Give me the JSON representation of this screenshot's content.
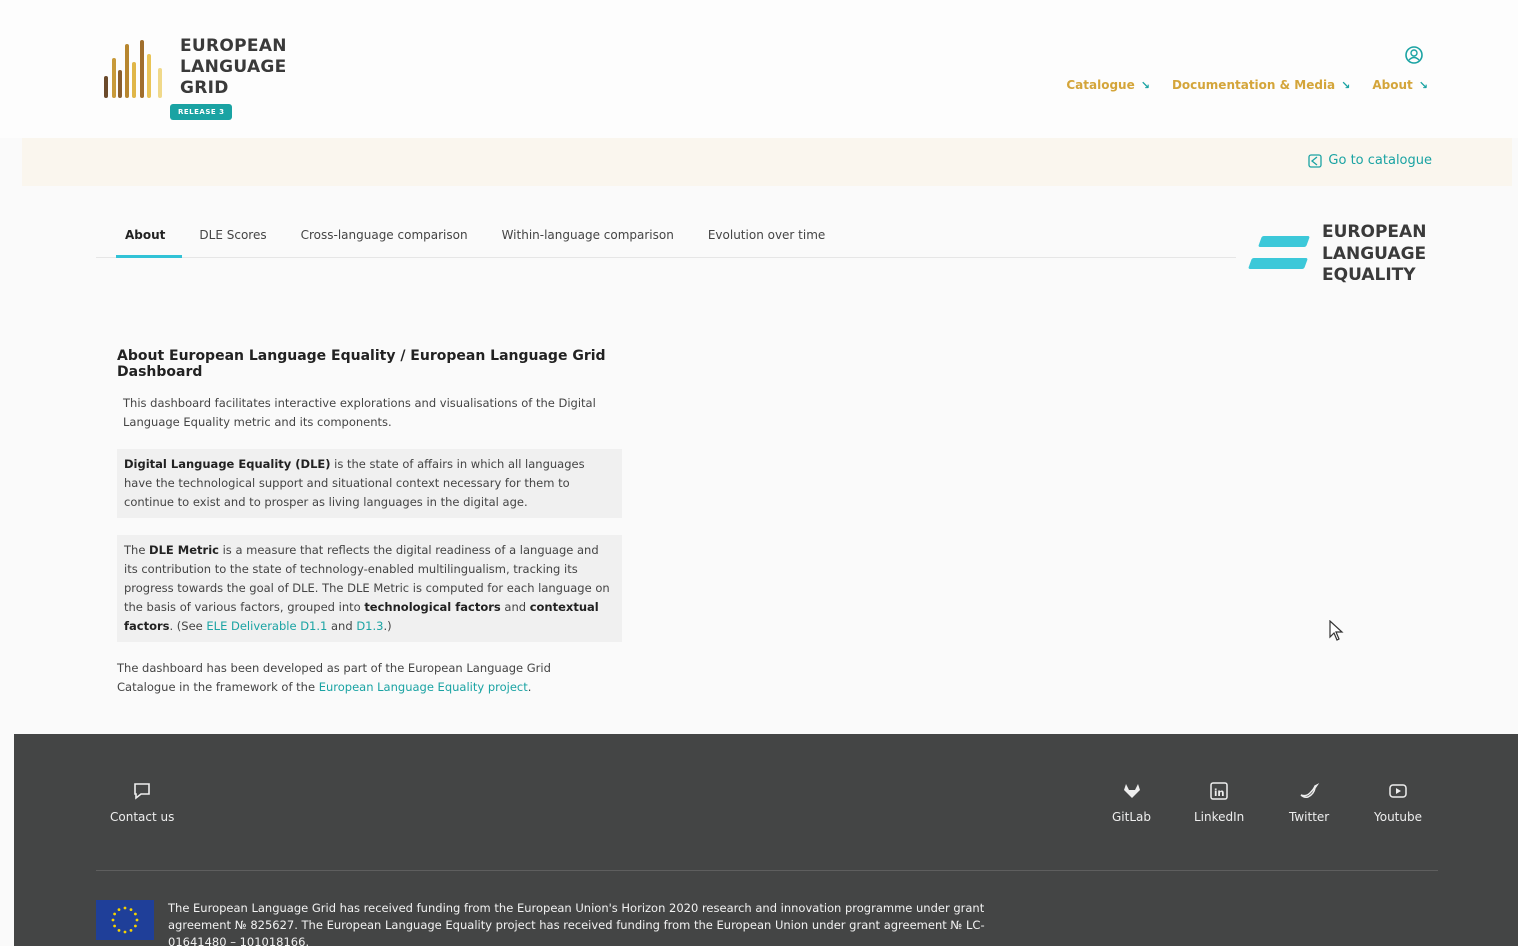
{
  "header": {
    "logo_lines": [
      "EUROPEAN",
      "LANGUAGE",
      "GRID"
    ],
    "release_badge": "RELEASE 3",
    "nav": [
      {
        "label": "Catalogue"
      },
      {
        "label": "Documentation & Media"
      },
      {
        "label": "About"
      }
    ],
    "go_to_catalogue": "Go to catalogue"
  },
  "tabs": [
    {
      "label": "About",
      "active": true
    },
    {
      "label": "DLE Scores",
      "active": false
    },
    {
      "label": "Cross-language comparison",
      "active": false
    },
    {
      "label": "Within-language comparison",
      "active": false
    },
    {
      "label": "Evolution over time",
      "active": false
    }
  ],
  "ele_logo": [
    "EUROPEAN",
    "LANGUAGE",
    "EQUALITY"
  ],
  "content": {
    "title": "About European Language Equality / European Language Grid Dashboard",
    "intro": "This dashboard facilitates interactive explorations and visualisations of the Digital Language Equality metric and its components.",
    "dle_box": {
      "term": "Digital Language Equality (DLE)",
      "text": " is the state of affairs in which all languages have the technological support and situational context necessary for them to continue to exist and to prosper as living languages in the digital age."
    },
    "metric_box": {
      "pre": "The ",
      "term": "DLE Metric",
      "text1": " is a measure that reflects the digital readiness of a language and its contribution to the state of technology-enabled multilingualism, tracking its progress towards the goal of DLE. The DLE Metric is computed for each language on the basis of various factors, grouped into ",
      "tech": "technological factors",
      "and": " and ",
      "context": "contextual factors",
      "see": ". (See ",
      "link1": "ELE Deliverable D1.1",
      "and2": " and ",
      "link2": "D1.3",
      "close": ".)"
    },
    "outro": {
      "text": "The dashboard has been developed as part of the European Language Grid Catalogue in the framework of the ",
      "link": "European Language Equality project",
      "end": "."
    }
  },
  "footer": {
    "contact": "Contact us",
    "social": [
      {
        "label": "GitLab",
        "icon": "gitlab-icon"
      },
      {
        "label": "LinkedIn",
        "icon": "linkedin-icon"
      },
      {
        "label": "Twitter",
        "icon": "twitter-icon"
      },
      {
        "label": "Youtube",
        "icon": "youtube-icon"
      }
    ],
    "funding": "The European Language Grid has received funding from the European Union's Horizon 2020 research and innovation programme under grant agreement № 825627. The European Language Equality project has received funding from the European Union under grant agreement № LC-01641480 – 101018166."
  },
  "colors": {
    "accent_gold": "#d4a53a",
    "accent_teal": "#1aa3a3",
    "ele_cyan": "#3cc8d9",
    "footer_bg": "#444545"
  }
}
